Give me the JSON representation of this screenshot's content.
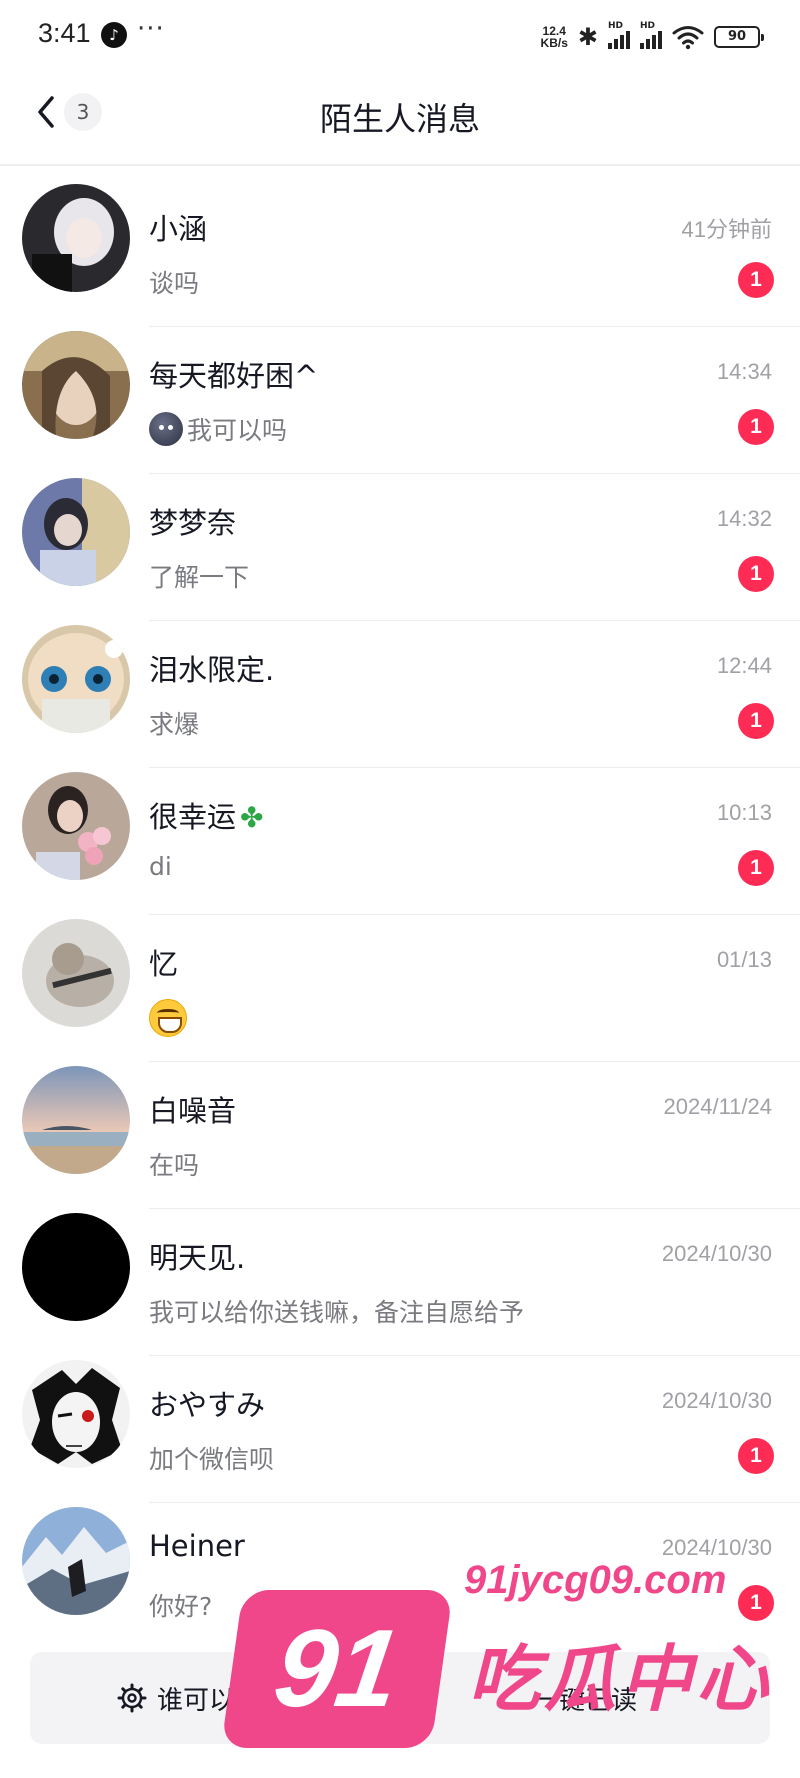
{
  "status_bar": {
    "time": "3:41",
    "more": "···",
    "net_speed_value": "12.4",
    "net_speed_unit": "KB/s",
    "signal_label": "HD",
    "battery": "90"
  },
  "header": {
    "back_count": "3",
    "title": "陌生人消息"
  },
  "messages": [
    {
      "name": "小涵",
      "preview": "谈吗",
      "time": "41分钟前",
      "unread": "1"
    },
    {
      "name": "每天都好困^",
      "preview": "我可以吗",
      "time": "14:34",
      "unread": "1"
    },
    {
      "name": "梦梦奈",
      "preview": "了解一下",
      "time": "14:32",
      "unread": "1"
    },
    {
      "name": "泪水限定.",
      "preview": "求爆",
      "time": "12:44",
      "unread": "1"
    },
    {
      "name": "很幸运",
      "preview": "di",
      "time": "10:13",
      "unread": "1"
    },
    {
      "name": "忆",
      "preview": "",
      "time": "01/13",
      "unread": ""
    },
    {
      "name": "白噪音",
      "preview": "在吗",
      "time": "2024/11/24",
      "unread": ""
    },
    {
      "name": "明天见.",
      "preview": "我可以给你送钱嘛，备注自愿给予",
      "time": "2024/10/30",
      "unread": ""
    },
    {
      "name": "おやすみ",
      "preview": "加个微信呗",
      "time": "2024/10/30",
      "unread": "1"
    },
    {
      "name": "Heiner",
      "preview": "你好?",
      "time": "2024/10/30",
      "unread": "1"
    }
  ],
  "bottom_bar": {
    "privacy_label": "谁可以私信我",
    "mark_read_label": "一键已读"
  },
  "watermark": {
    "badge": "91",
    "url": "91jycg09.com",
    "name": "吃瓜中心"
  },
  "colors": {
    "badge": "#fe2c55",
    "watermark": "#f0478b"
  }
}
